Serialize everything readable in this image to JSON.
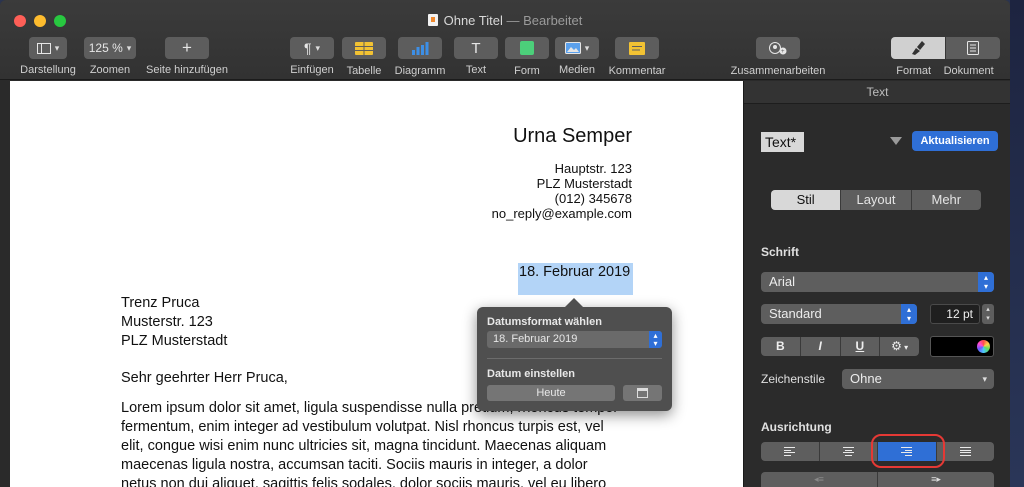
{
  "window": {
    "title": "Ohne Titel",
    "subtitle": "— Bearbeitet"
  },
  "toolbar": {
    "darstellung": "Darstellung",
    "zoom_value": "125 %",
    "zoom_label": "Zoomen",
    "add_page": "Seite hinzufügen",
    "add_page_glyph": "+",
    "einfuegen": "Einfügen",
    "einfuegen_glyph": "¶",
    "tabelle": "Tabelle",
    "diagramm": "Diagramm",
    "text": "Text",
    "text_glyph": "T",
    "form": "Form",
    "medien": "Medien",
    "kommentar": "Kommentar",
    "zusammenarbeiten": "Zusammenarbeiten",
    "format": "Format",
    "dokument": "Dokument"
  },
  "document": {
    "sender_name": "Urna Semper",
    "sender_lines": [
      "Hauptstr. 123",
      "PLZ Musterstadt",
      "(012) 345678",
      "no_reply@example.com"
    ],
    "date": "18. Februar 2019",
    "recipient_lines": [
      "Trenz Pruca",
      "Musterstr. 123",
      "PLZ Musterstadt"
    ],
    "salutation": "Sehr geehrter Herr Pruca,",
    "body_lines": [
      "Lorem ipsum dolor sit amet, ligula suspendisse nulla pretium, rhoncus tempor",
      "fermentum, enim integer ad vestibulum volutpat. Nisl rhoncus turpis est, vel",
      "elit, congue wisi enim nunc ultricies sit, magna tincidunt. Maecenas aliquam",
      "maecenas ligula nostra, accumsan taciti. Sociis mauris in integer, a dolor",
      "netus non dui aliquet, sagittis felis sodales, dolor sociis mauris, vel eu libero"
    ]
  },
  "date_popover": {
    "format_label": "Datumsformat wählen",
    "format_value": "18. Februar 2019",
    "set_label": "Datum einstellen",
    "today_button": "Heute"
  },
  "inspector": {
    "header": "Text",
    "paragraph_style": "Text*",
    "update_button": "Aktualisieren",
    "tabs": [
      "Stil",
      "Layout",
      "Mehr"
    ],
    "font_section": "Schrift",
    "font_family": "Arial",
    "font_weight": "Standard",
    "font_size": "12 pt",
    "bold": "B",
    "italic": "I",
    "underline": "U",
    "gear": "⚙︎",
    "char_styles_label": "Zeichenstile",
    "char_styles_value": "Ohne",
    "alignment_section": "Ausrichtung"
  },
  "colors": {
    "accent": "#2f6fd6",
    "selection": "#b3d4f7",
    "highlight_ring": "#e53935"
  }
}
